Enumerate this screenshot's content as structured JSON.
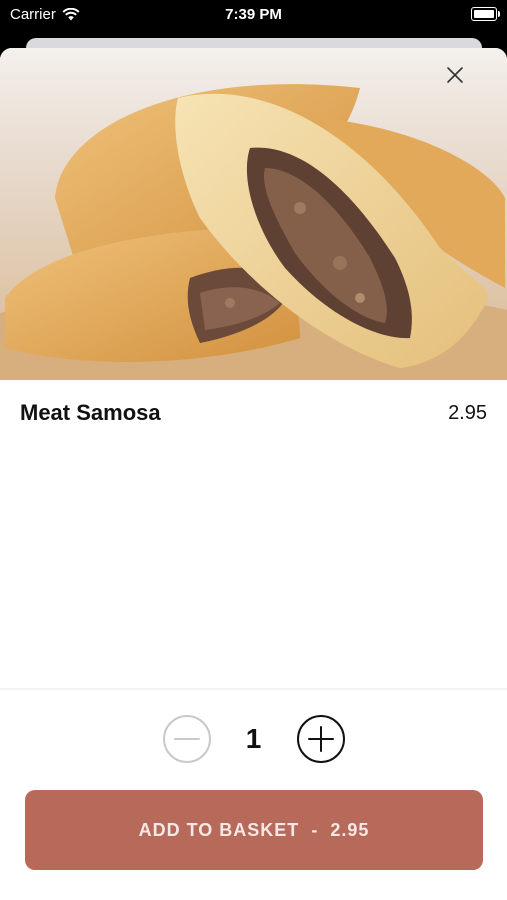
{
  "status_bar": {
    "carrier": "Carrier",
    "time": "7:39 PM"
  },
  "product": {
    "name": "Meat Samosa",
    "price": "2.95"
  },
  "quantity": {
    "value": "1"
  },
  "add_button": {
    "label": "ADD TO BASKET",
    "separator": "-",
    "price": "2.95"
  },
  "colors": {
    "accent": "#b86a5a",
    "text": "#111111",
    "background": "#ffffff"
  },
  "icons": {
    "close": "close-icon",
    "minus": "minus-circle-icon",
    "plus": "plus-circle-icon"
  }
}
